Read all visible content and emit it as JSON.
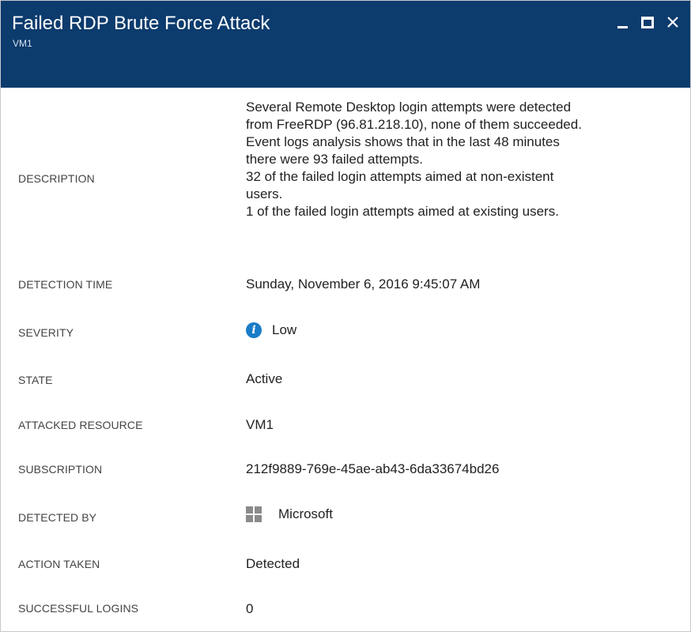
{
  "window": {
    "title": "Failed RDP Brute Force Attack",
    "subtitle": "VM1",
    "controls": {
      "minimize": "minimize",
      "maximize": "maximize",
      "close": "close"
    },
    "colors": {
      "titlebar": "#0c3b6d",
      "info_icon": "#1a7dc7"
    }
  },
  "details": {
    "description": {
      "label": "DESCRIPTION",
      "lines": [
        "Several Remote Desktop login attempts were detected",
        "from FreeRDP (96.81.218.10), none of them succeeded.",
        "Event logs analysis shows that in the last 48 minutes",
        "there were 93 failed attempts.",
        "32 of the failed login attempts aimed at non-existent",
        "users.",
        "1 of the failed login attempts aimed at existing users."
      ]
    },
    "detection_time": {
      "label": "DETECTION TIME",
      "value": "Sunday, November 6, 2016 9:45:07 AM"
    },
    "severity": {
      "label": "SEVERITY",
      "value": "Low",
      "icon": "info-icon",
      "icon_glyph": "i"
    },
    "state": {
      "label": "STATE",
      "value": "Active"
    },
    "attacked_resource": {
      "label": "ATTACKED RESOURCE",
      "value": "VM1"
    },
    "subscription": {
      "label": "SUBSCRIPTION",
      "value": "212f9889-769e-45ae-ab43-6da33674bd26"
    },
    "detected_by": {
      "label": "DETECTED BY",
      "value": "Microsoft",
      "icon": "windows-logo-icon"
    },
    "action_taken": {
      "label": "ACTION TAKEN",
      "value": "Detected"
    },
    "successful_logins": {
      "label": "SUCCESSFUL LOGINS",
      "value": "0"
    }
  }
}
